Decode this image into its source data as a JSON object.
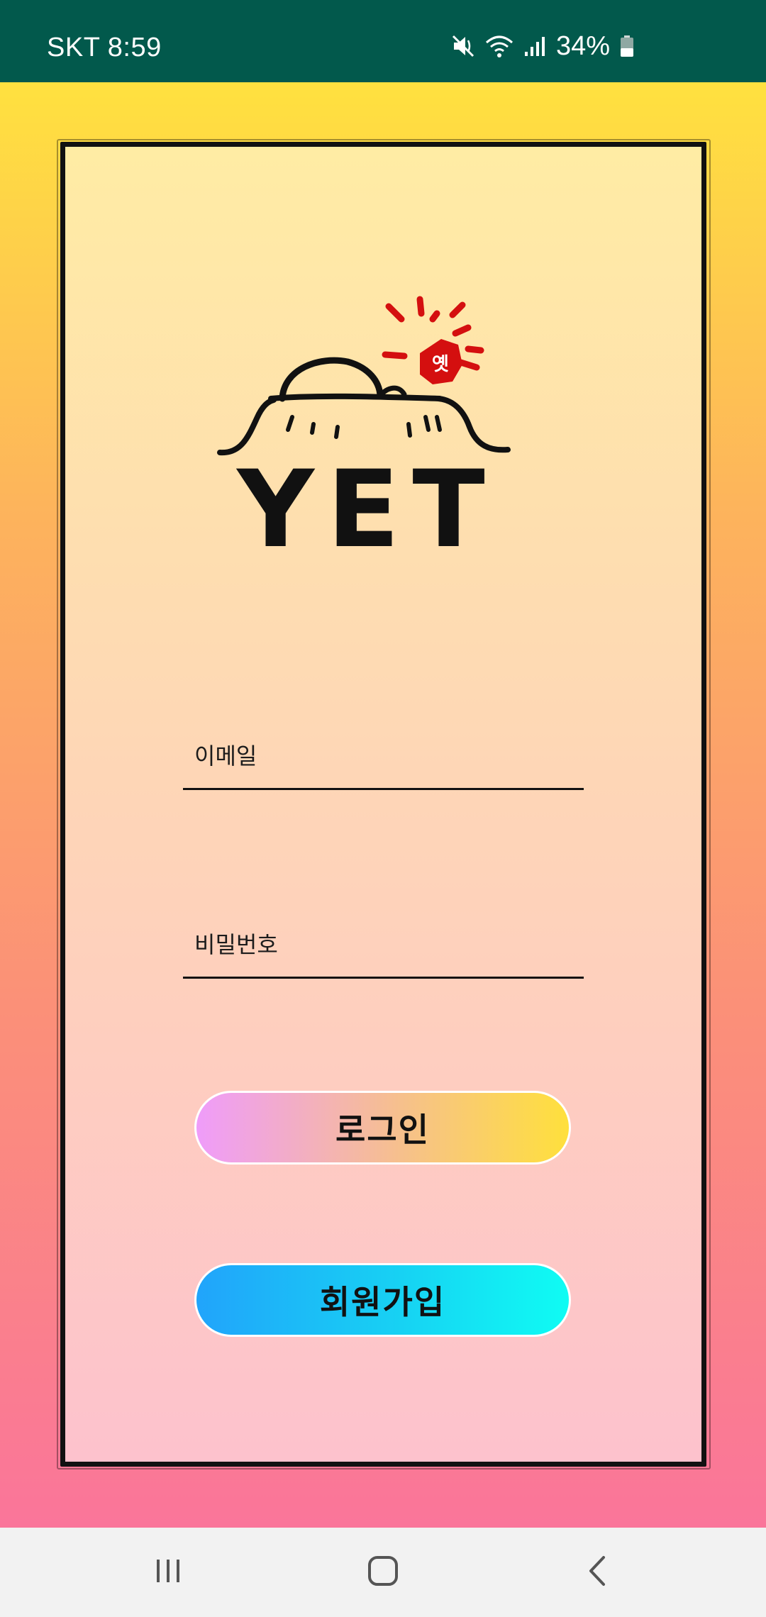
{
  "status_bar": {
    "carrier_time": "SKT 8:59",
    "battery": "34%",
    "icons": [
      "mute-icon",
      "wifi-icon",
      "signal-icon",
      "battery-icon"
    ]
  },
  "logo": {
    "brand_text": "YET",
    "stamp_text": "옛"
  },
  "form": {
    "email_placeholder": "이메일",
    "email_value": "",
    "password_placeholder": "비밀번호",
    "password_value": ""
  },
  "buttons": {
    "login_label": "로그인",
    "signup_label": "회원가입"
  },
  "nav_bar": {
    "icons": [
      "recent-apps-icon",
      "home-icon",
      "back-icon"
    ]
  },
  "colors": {
    "status_bar": "#02594c",
    "background_top": "#ffe13f",
    "background_bottom": "#fa759a",
    "stamp_red": "#d40f0f"
  }
}
